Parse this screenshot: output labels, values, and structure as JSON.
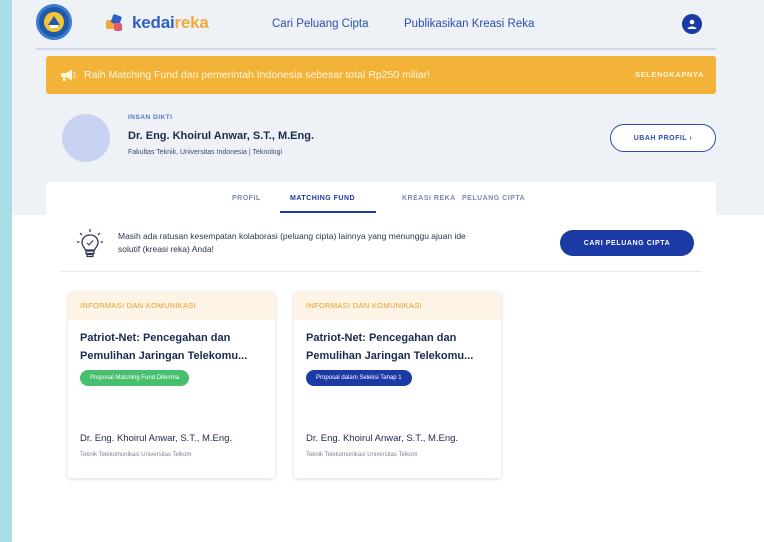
{
  "header": {
    "brand_part1": "kedai",
    "brand_part2": "reka",
    "nav": [
      {
        "label": "Cari Peluang Cipta"
      },
      {
        "label": "Publikasikan Kreasi Reka"
      }
    ]
  },
  "banner": {
    "text": "Raih Matching Fund dari pemerintah Indonesia sebesar total Rp250 miliar!",
    "link": "SELENGKAPNYA"
  },
  "profile": {
    "role": "INSAN DIKTI",
    "name": "Dr. Eng. Khoirul Anwar, S.T., M.Eng.",
    "subtitle": "Fakultas Teknik, Universitas Indonesia  |  Teknologi",
    "edit_label": "UBAH PROFIL  ›"
  },
  "tabs": [
    {
      "label": "PROFIL",
      "active": false
    },
    {
      "label": "MATCHING FUND",
      "active": true
    },
    {
      "label": "KREASI REKA",
      "active": false
    },
    {
      "label": "PELUANG CIPTA",
      "active": false
    }
  ],
  "info": {
    "text": "Masih ada ratusan kesempatan kolaborasi (peluang cipta) lainnya yang menunggu ajuan ide solutif (kreasi reka) Anda!",
    "cta": "CARI PELUANG CIPTA"
  },
  "cards": [
    {
      "category": "INFORMASI DAN KOMUNIKASI",
      "title": "Patriot-Net: Pencegahan dan Pemulihan Jaringan Telekomu...",
      "badge": "Proposal Matching Fund Diterima",
      "badge_color": "#47bf6f",
      "author": "Dr. Eng. Khoirul Anwar, S.T., M.Eng.",
      "affiliation": "Teknik Telekomunikasi Universitas Telkom"
    },
    {
      "category": "INFORMASI DAN KOMUNIKASI",
      "title": "Patriot-Net: Pencegahan dan Pemulihan Jaringan Telekomu...",
      "badge": "Proposal dalam Seleksi Tahap 1",
      "badge_color": "#1c3aa6",
      "author": "Dr. Eng. Khoirul Anwar, S.T., M.Eng.",
      "affiliation": "Teknik Telekomunikasi Universitas Telkom"
    }
  ],
  "colors": {
    "primary": "#1c3aa6",
    "banner": "#f3b339",
    "category": "#e89c2c"
  }
}
